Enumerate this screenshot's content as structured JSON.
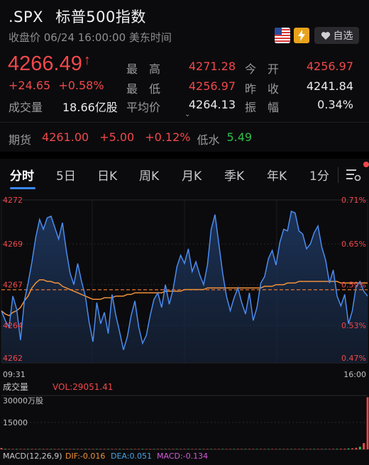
{
  "header": {
    "symbol": ".SPX",
    "name": "标普500指数",
    "status": "收盘价 06/24 16:00:00 美东时间",
    "watch_label": "自选"
  },
  "quote": {
    "price": "4266.49",
    "arrow": "↑",
    "change": "+24.65",
    "change_pct": "+0.58%",
    "volume_label": "成交量",
    "volume": "18.66亿股",
    "stats": [
      {
        "label": "最　高",
        "value": "4271.28",
        "color": "#f2484b"
      },
      {
        "label": "今　开",
        "value": "4256.97",
        "color": "#f2484b"
      },
      {
        "label": "最　低",
        "value": "4256.97",
        "color": "#f2484b"
      },
      {
        "label": "昨　收",
        "value": "4241.84",
        "color": "#ececec"
      },
      {
        "label": "平均价",
        "value": "4264.13",
        "color": "#ececec"
      },
      {
        "label": "振　幅",
        "value": "0.34%",
        "color": "#ececec"
      }
    ]
  },
  "futures": {
    "label": "期货",
    "price": "4261.00",
    "change": "+5.00",
    "change_pct": "+0.12%",
    "basis_label": "低水",
    "basis": "5.49"
  },
  "tabs": [
    "分时",
    "5日",
    "日K",
    "周K",
    "月K",
    "季K",
    "年K",
    "1分"
  ],
  "chart_data": {
    "type": "line",
    "y_ticks_left": [
      "4272",
      "4269",
      "4267",
      "4264",
      "4262"
    ],
    "y_ticks_right": [
      "0.71%",
      "0.65%",
      "0.59%",
      "0.53%",
      "0.47%"
    ],
    "ylim": [
      4262,
      4272
    ],
    "x_start": "09:31",
    "x_end": "16:00",
    "reference_line": 4266.49,
    "series": [
      {
        "name": "price",
        "color": "#4a8cf0",
        "values": [
          4265.2,
          4264.6,
          4264.2,
          4266.1,
          4265.3,
          4263.4,
          4265.8,
          4266.9,
          4268.2,
          4269.7,
          4270.8,
          4270.2,
          4270.9,
          4271.0,
          4270.3,
          4269.6,
          4270.6,
          4268.9,
          4267.5,
          4266.8,
          4268.1,
          4267.0,
          4266.1,
          4264.5,
          4263.3,
          4265.7,
          4264.4,
          4265.1,
          4263.8,
          4266.2,
          4264.9,
          4263.9,
          4262.8,
          4263.6,
          4264.9,
          4265.8,
          4264.2,
          4263.2,
          4263.7,
          4264.9,
          4265.9,
          4266.3,
          4265.4,
          4266.8,
          4265.6,
          4266.5,
          4267.9,
          4268.6,
          4268.1,
          4269.0,
          4267.6,
          4268.2,
          4267.4,
          4266.8,
          4268.0,
          4270.2,
          4271.1,
          4269.3,
          4267.5,
          4266.1,
          4265.2,
          4266.0,
          4266.6,
          4265.7,
          4265.0,
          4266.3,
          4264.6,
          4265.4,
          4266.9,
          4267.3,
          4268.4,
          4268.9,
          4268.0,
          4269.4,
          4270.2,
          4270.1,
          4271.3,
          4271.2,
          4270.1,
          4269.9,
          4269.0,
          4269.3,
          4270.0,
          4270.4,
          4269.1,
          4268.3,
          4266.9,
          4267.7,
          4266.1,
          4265.5,
          4266.2,
          4264.4,
          4265.2,
          4266.7,
          4267.0,
          4266.4,
          4266.1
        ]
      },
      {
        "name": "avg",
        "color": "#f0913a",
        "values": [
          4265.2,
          4265.0,
          4264.9,
          4265.1,
          4265.2,
          4265.4,
          4265.8,
          4266.1,
          4266.6,
          4266.9,
          4267.1,
          4267.1,
          4267.0,
          4267.0,
          4266.9,
          4266.9,
          4266.7,
          4266.6,
          4266.5,
          4266.4,
          4266.3,
          4266.2,
          4266.1,
          4266.0,
          4265.9,
          4265.9,
          4265.9,
          4266.0,
          4266.0,
          4266.0,
          4266.1,
          4266.1,
          4266.1,
          4266.2,
          4266.2,
          4266.3,
          4266.3,
          4266.3,
          4266.3,
          4266.3,
          4266.3,
          4266.3,
          4266.3,
          4266.4,
          4266.4,
          4266.4,
          4266.4,
          4266.4,
          4266.5,
          4266.5,
          4266.5,
          4266.5,
          4266.5,
          4266.5,
          4266.6,
          4266.6,
          4266.6,
          4266.6,
          4266.6,
          4266.6,
          4266.6,
          4266.6,
          4266.6,
          4266.6,
          4266.6,
          4266.6,
          4266.6,
          4266.6,
          4266.6,
          4266.7,
          4266.7,
          4266.7,
          4266.8,
          4266.8,
          4266.8,
          4266.9,
          4266.9,
          4266.9,
          4267.0,
          4267.0,
          4267.0,
          4267.0,
          4267.0,
          4267.0,
          4267.0,
          4267.0,
          4267.0,
          4267.0,
          4267.0,
          4266.9,
          4266.9,
          4266.9,
          4266.9,
          4266.9,
          4266.9,
          4266.9,
          4266.9
        ]
      }
    ],
    "volume": {
      "label": "成交量",
      "vol_text": "VOL:29051.41",
      "ticks": [
        "30000万股",
        "15000"
      ],
      "ylim": [
        0,
        30000
      ],
      "values": [
        800,
        300,
        200,
        250,
        200,
        150,
        180,
        200,
        160,
        150,
        140,
        130,
        150,
        120,
        130,
        110,
        140,
        120,
        110,
        100,
        120,
        110,
        100,
        90,
        110,
        100,
        90,
        100,
        95,
        90,
        100,
        90,
        85,
        95,
        90,
        85,
        90,
        80,
        85,
        90,
        80,
        85,
        80,
        90,
        85,
        80,
        85,
        90,
        80,
        85,
        80,
        85,
        90,
        85,
        80,
        90,
        85,
        80,
        85,
        90,
        85,
        90,
        95,
        90,
        100,
        95,
        100,
        105,
        100,
        110,
        105,
        110,
        115,
        120,
        115,
        120,
        125,
        130,
        140,
        150,
        160,
        150,
        170,
        180,
        200,
        220,
        250,
        280,
        300,
        350,
        400,
        500,
        600,
        900,
        1500,
        3500,
        29051
      ]
    },
    "macd": {
      "label": "MACD(12,26,9)",
      "dif": "DIF:-0.016",
      "dea": "DEA:0.051",
      "macd": "MACD:-0.134"
    }
  }
}
